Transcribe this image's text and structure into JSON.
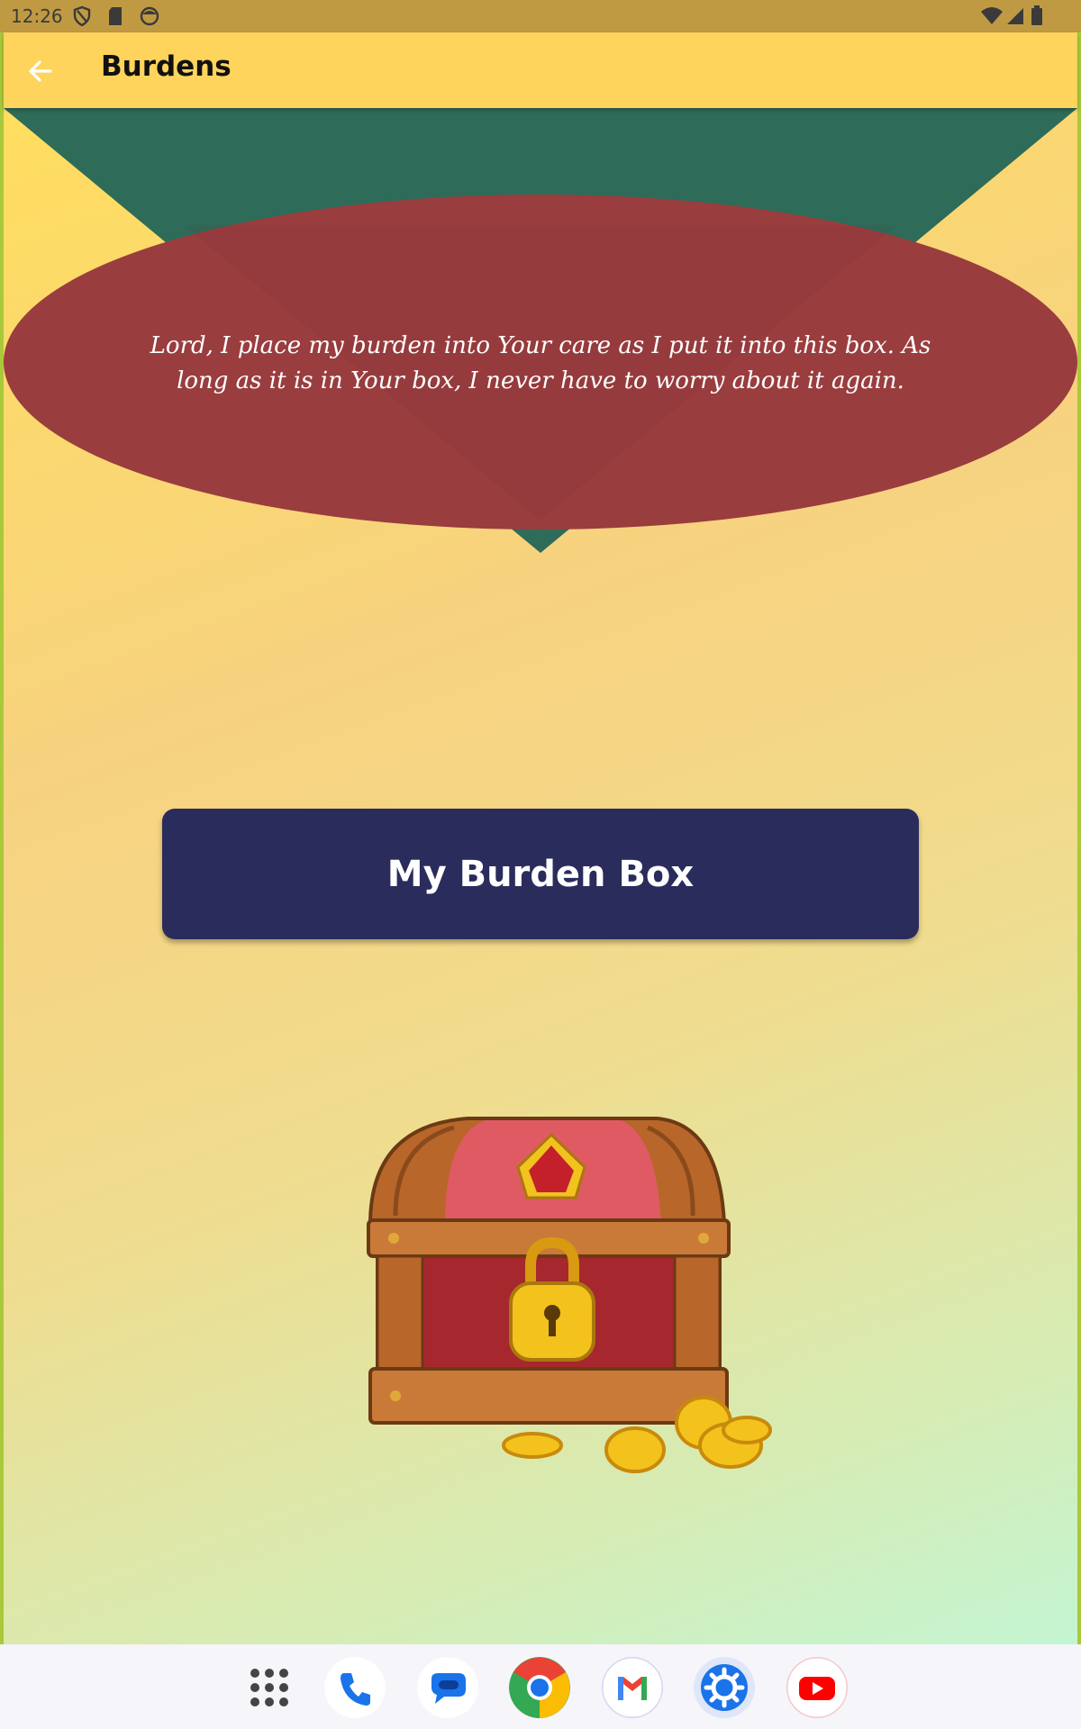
{
  "status_bar": {
    "time": "12:26",
    "left_icons": [
      "shield-icon",
      "sd-card-icon",
      "face-icon"
    ],
    "right_icons": [
      "wifi-icon",
      "signal-icon",
      "battery-icon"
    ]
  },
  "app_bar": {
    "title": "Burdens",
    "back_icon": "arrow-back-icon"
  },
  "banner": {
    "prayer": "Lord, I place my burden into Your care as I put it into this box. As long as it is in Your box, I never have to worry about it again."
  },
  "main": {
    "button_label": "My Burden Box",
    "illustration": "treasure-chest-icon"
  },
  "dock": {
    "apps": [
      "app-drawer-icon",
      "phone-icon",
      "messages-icon",
      "chrome-icon",
      "gmail-icon",
      "settings-icon",
      "youtube-icon"
    ]
  },
  "colors": {
    "status_bar": "#c09a43",
    "app_bar": "#ffd45c",
    "banner_green": "#2e6b58",
    "banner_red": "#9a3d3f",
    "button": "#2a2c5c"
  }
}
